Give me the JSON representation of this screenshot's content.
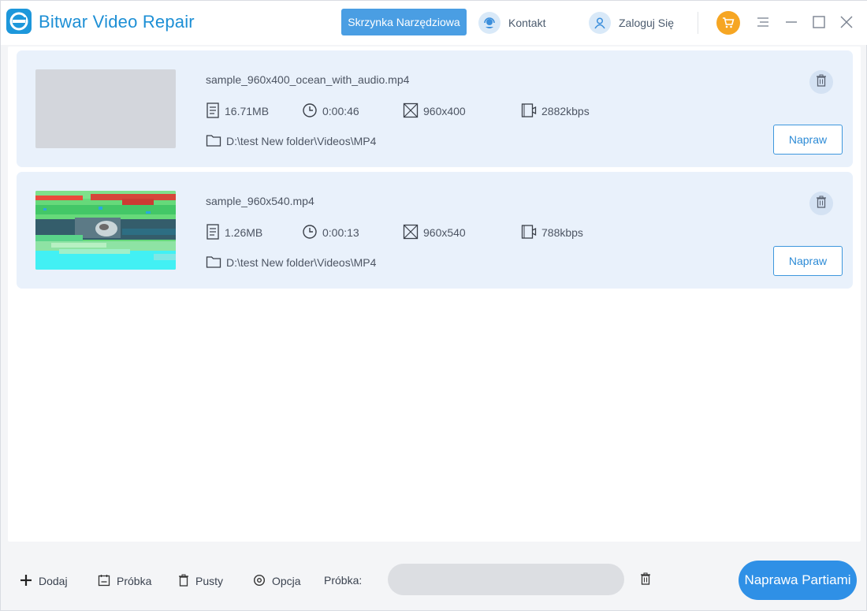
{
  "app": {
    "title": "Bitwar Video Repair",
    "logo_icon": "bitwar-logo-icon",
    "brand_color": "#1d97db"
  },
  "header": {
    "toolbox_label": "Skrzynka Narzędziowa",
    "contact_label": "Kontakt",
    "contact_icon": "headset-icon",
    "login_label": "Zaloguj Się",
    "login_icon": "user-icon",
    "cart_icon": "cart-icon",
    "window_controls": [
      "menu-icon",
      "minimize-icon",
      "maximize-icon",
      "close-icon"
    ]
  },
  "files": [
    {
      "name": "sample_960x400_ocean_with_audio.mp4",
      "size": "16.71MB",
      "duration": "0:00:46",
      "resolution": "960x400",
      "bitrate": "2882kbps",
      "path": "D:\\test New folder\\Videos\\MP4",
      "thumbnail": "blank",
      "repair_label": "Napraw"
    },
    {
      "name": "sample_960x540.mp4",
      "size": "1.26MB",
      "duration": "0:00:13",
      "resolution": "960x540",
      "bitrate": "788kbps",
      "path": "D:\\test New folder\\Videos\\MP4",
      "thumbnail": "corrupted-frame",
      "repair_label": "Napraw"
    }
  ],
  "footer": {
    "add_label": "Dodaj",
    "sample_btn_label": "Próbka",
    "clear_label": "Pusty",
    "option_label": "Opcja",
    "sample_field_label": "Próbka:",
    "batch_repair_label": "Naprawa Partiami"
  },
  "colors": {
    "accent": "#2f90e6",
    "card_bg": "#e9f1fb",
    "cart": "#f6a623"
  }
}
